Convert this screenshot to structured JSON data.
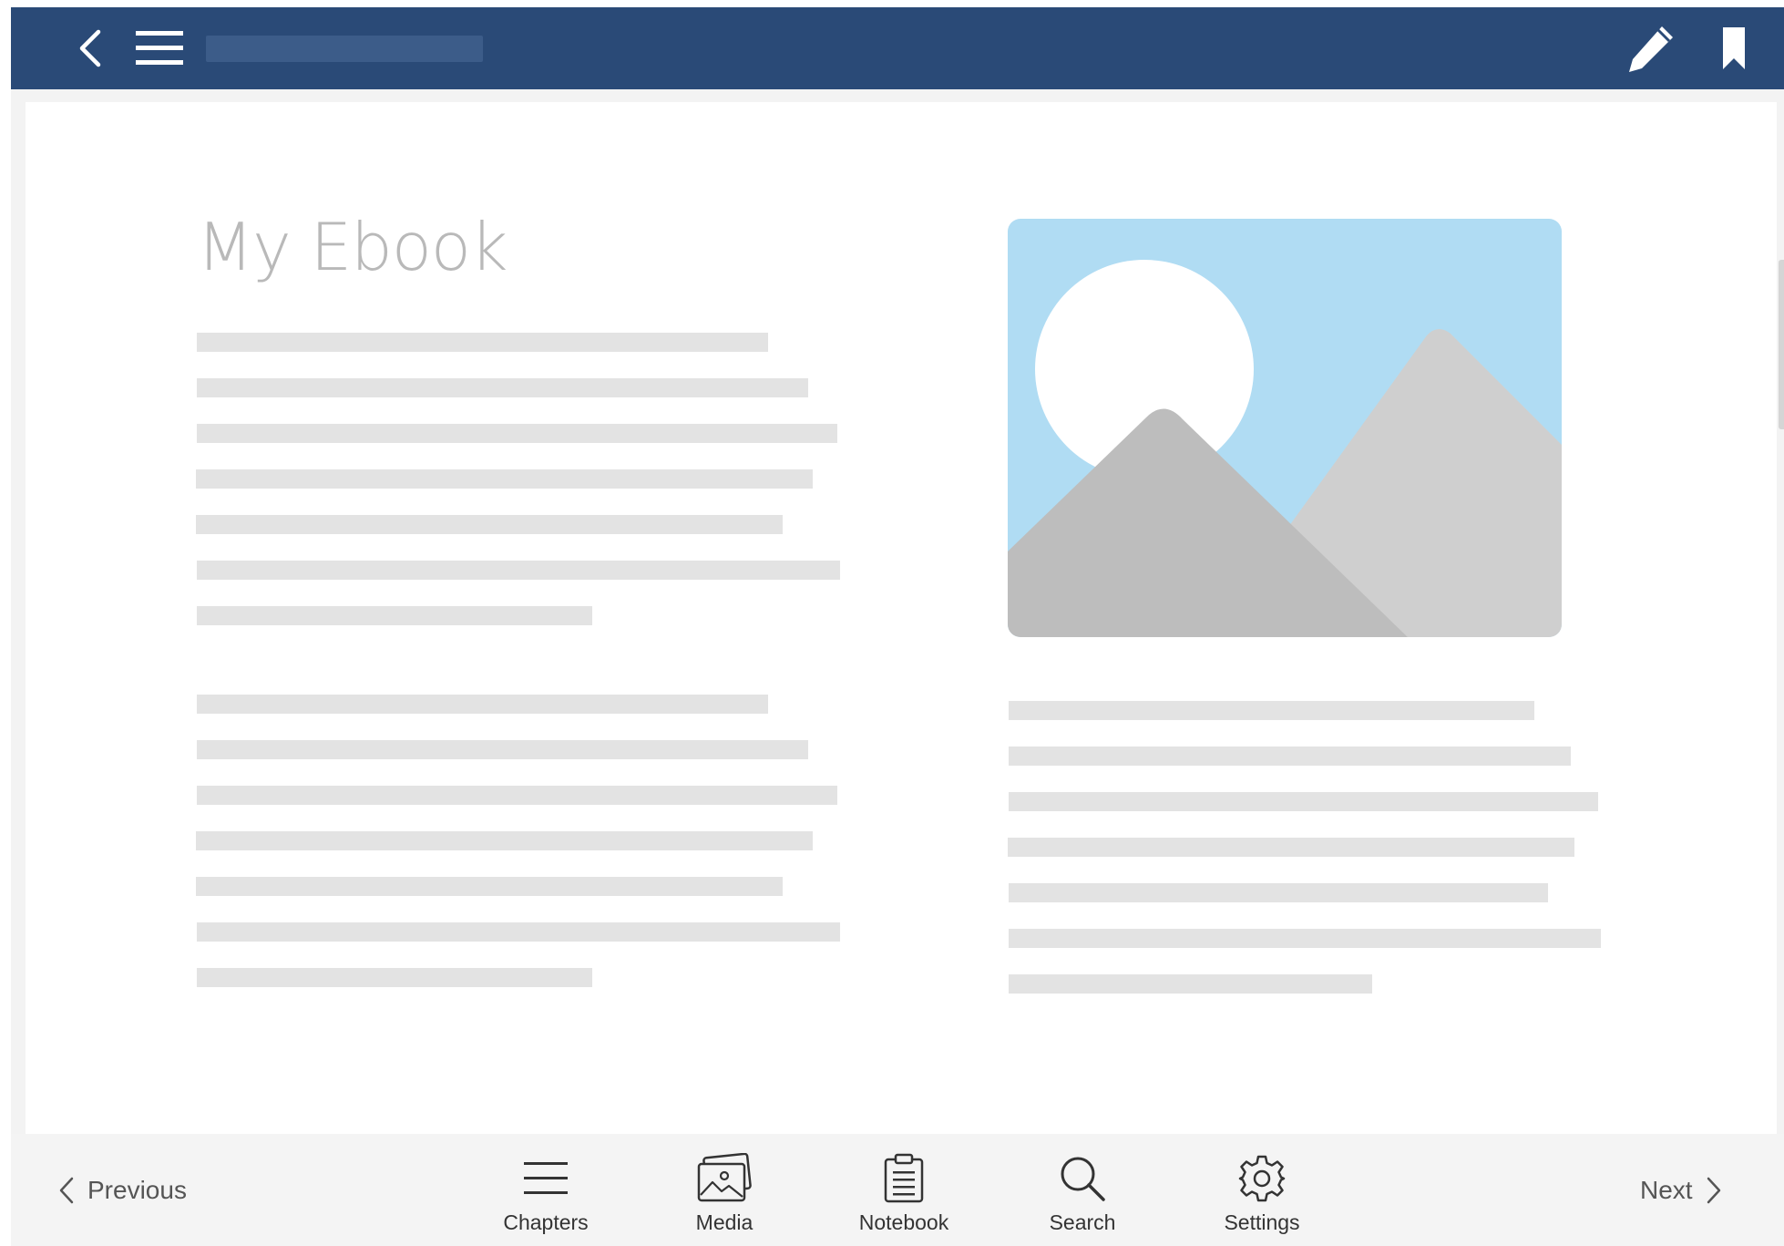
{
  "colors": {
    "topbar": "#2a4a77",
    "title_text": "#b9b9b9",
    "placeholder_bar": "#e3e3e3",
    "sky": "#b0dcf3",
    "mountain_back": "#cfcfcf",
    "mountain_front": "#bdbdbd",
    "toolbar_text": "#333333"
  },
  "topbar": {
    "back_icon": "chevron-left-icon",
    "menu_icon": "hamburger-menu-icon",
    "edit_icon": "pencil-icon",
    "bookmark_icon": "bookmark-icon"
  },
  "page": {
    "title": "My Ebook",
    "image_icon": "landscape-image-placeholder"
  },
  "bottombar": {
    "previous_label": "Previous",
    "next_label": "Next",
    "tools": [
      {
        "label": "Chapters",
        "icon": "list-icon"
      },
      {
        "label": "Media",
        "icon": "images-icon"
      },
      {
        "label": "Notebook",
        "icon": "clipboard-icon"
      },
      {
        "label": "Search",
        "icon": "search-icon"
      },
      {
        "label": "Settings",
        "icon": "gear-icon"
      }
    ]
  }
}
